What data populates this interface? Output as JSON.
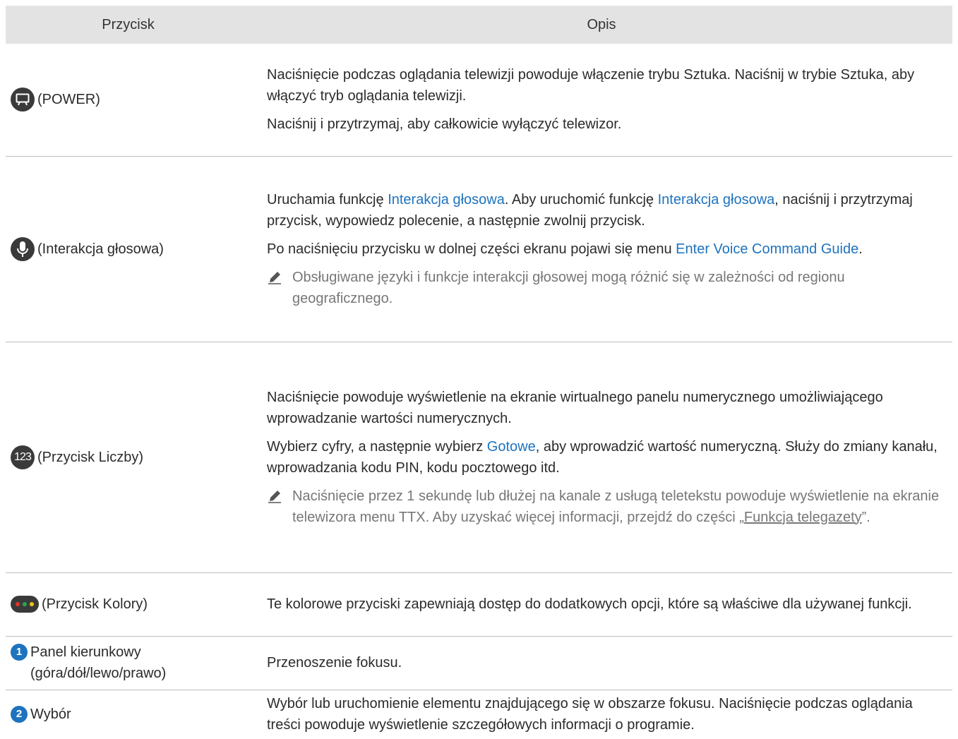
{
  "header": {
    "col1": "Przycisk",
    "col2": "Opis"
  },
  "rows": [
    {
      "button": "(POWER)",
      "paragraphs": [
        "Naciśnięcie podczas oglądania telewizji powoduje włączenie trybu Sztuka. Naciśnij w trybie Sztuka, aby włączyć tryb oglądania telewizji.",
        "Naciśnij i przytrzymaj, aby całkowicie wyłączyć telewizor."
      ]
    },
    {
      "button": "(Interakcja głosowa)",
      "p1_a": "Uruchamia funkcję ",
      "p1_link1": "Interakcja głosowa",
      "p1_b": ". Aby uruchomić funkcję ",
      "p1_link2": "Interakcja głosowa",
      "p1_c": ", naciśnij i przytrzymaj przycisk, wypowiedz polecenie, a następnie zwolnij przycisk.",
      "p2_a": "Po naciśnięciu przycisku w dolnej części ekranu pojawi się menu ",
      "p2_link": "Enter Voice Command Guide",
      "p2_b": ".",
      "note": "Obsługiwane języki i funkcje interakcji głosowej mogą różnić się w zależności od regionu geograficznego."
    },
    {
      "icon_text": "123",
      "button": "(Przycisk Liczby)",
      "p1": "Naciśnięcie powoduje wyświetlenie na ekranie wirtualnego panelu numerycznego umożliwiającego wprowadzanie wartości numerycznych.",
      "p2_a": "Wybierz cyfry, a następnie wybierz ",
      "p2_link": "Gotowe",
      "p2_b": ", aby wprowadzić wartość numeryczną. Służy do zmiany kanału, wprowadzania kodu PIN, kodu pocztowego itd.",
      "note_a": "Naciśnięcie przez 1 sekundę lub dłużej na kanale z usługą teletekstu powoduje wyświetlenie na ekranie telewizora menu TTX. Aby uzyskać więcej informacji, przejdź do części „",
      "note_link": "Funkcja telegazety",
      "note_b": "”."
    },
    {
      "button": "(Przycisk Kolory)",
      "p1": "Te kolorowe przyciski zapewniają dostęp do dodatkowych opcji, które są właściwe dla używanej funkcji.",
      "dot_colors": [
        "#e0342b",
        "#2aa84a",
        "#f2c318"
      ]
    },
    {
      "icon_text": "1",
      "button": "Panel kierunkowy (góra/dół/lewo/prawo)",
      "p1": "Przenoszenie fokusu."
    },
    {
      "icon_text": "2",
      "button": "Wybór",
      "p1": "Wybór lub uruchomienie elementu znajdującego się w obszarze fokusu. Naciśnięcie podczas oglądania treści powoduje wyświetlenie szczegółowych informacji o programie."
    }
  ]
}
